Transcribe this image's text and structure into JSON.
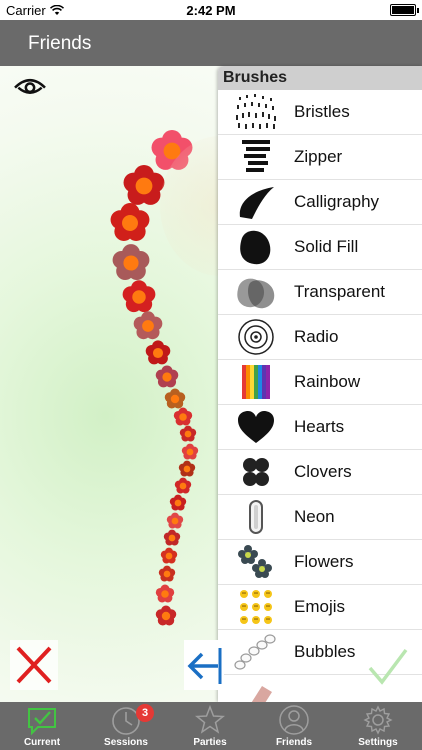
{
  "status_bar": {
    "carrier": "Carrier",
    "time": "2:42 PM"
  },
  "nav": {
    "title": "Friends"
  },
  "brushes": {
    "header": "Brushes",
    "items": [
      {
        "label": "Bristles",
        "icon": "bristles-icon"
      },
      {
        "label": "Zipper",
        "icon": "zipper-icon"
      },
      {
        "label": "Calligraphy",
        "icon": "calligraphy-icon"
      },
      {
        "label": "Solid Fill",
        "icon": "solid-fill-icon"
      },
      {
        "label": "Transparent",
        "icon": "transparent-icon"
      },
      {
        "label": "Radio",
        "icon": "radio-icon"
      },
      {
        "label": "Rainbow",
        "icon": "rainbow-icon"
      },
      {
        "label": "Hearts",
        "icon": "hearts-icon"
      },
      {
        "label": "Clovers",
        "icon": "clovers-icon"
      },
      {
        "label": "Neon",
        "icon": "neon-icon"
      },
      {
        "label": "Flowers",
        "icon": "flowers-icon"
      },
      {
        "label": "Emojis",
        "icon": "emojis-icon"
      },
      {
        "label": "Bubbles",
        "icon": "bubbles-icon"
      }
    ]
  },
  "tabs": [
    {
      "label": "Current",
      "icon": "chat-check-icon",
      "active": true
    },
    {
      "label": "Sessions",
      "icon": "clock-icon",
      "badge": "3"
    },
    {
      "label": "Parties",
      "icon": "star-icon"
    },
    {
      "label": "Friends",
      "icon": "person-icon"
    },
    {
      "label": "Settings",
      "icon": "gear-icon"
    }
  ],
  "colors": {
    "nav": "#6a6a6a",
    "accent_green": "#43c443",
    "cancel_red": "#e02020",
    "back_blue": "#1a6fc4",
    "badge": "#e53935"
  }
}
